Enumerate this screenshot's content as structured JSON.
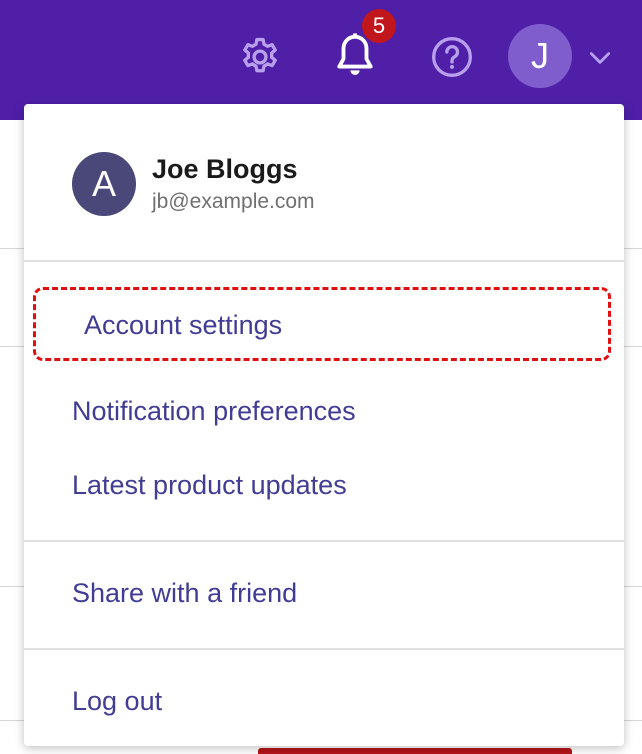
{
  "header": {
    "background_color": "#4f1fa8",
    "settings_icon": "gear-icon",
    "notifications_icon": "bell-icon",
    "notification_count": "5",
    "help_icon": "question-circle-icon",
    "user_initial": "J",
    "menu_toggle_icon": "chevron-down-icon"
  },
  "profile": {
    "avatar_initial": "A",
    "name": "Joe Bloggs",
    "email": "jb@example.com"
  },
  "menu": {
    "items": [
      {
        "label": "Account settings",
        "focused": true
      },
      {
        "label": "Notification preferences"
      },
      {
        "label": "Latest product updates"
      },
      {
        "label": "Share with a friend"
      },
      {
        "label": "Log out"
      }
    ]
  },
  "colors": {
    "menu_text": "#413c94",
    "focus_ring": "#e01010",
    "badge": "#c0161c"
  }
}
